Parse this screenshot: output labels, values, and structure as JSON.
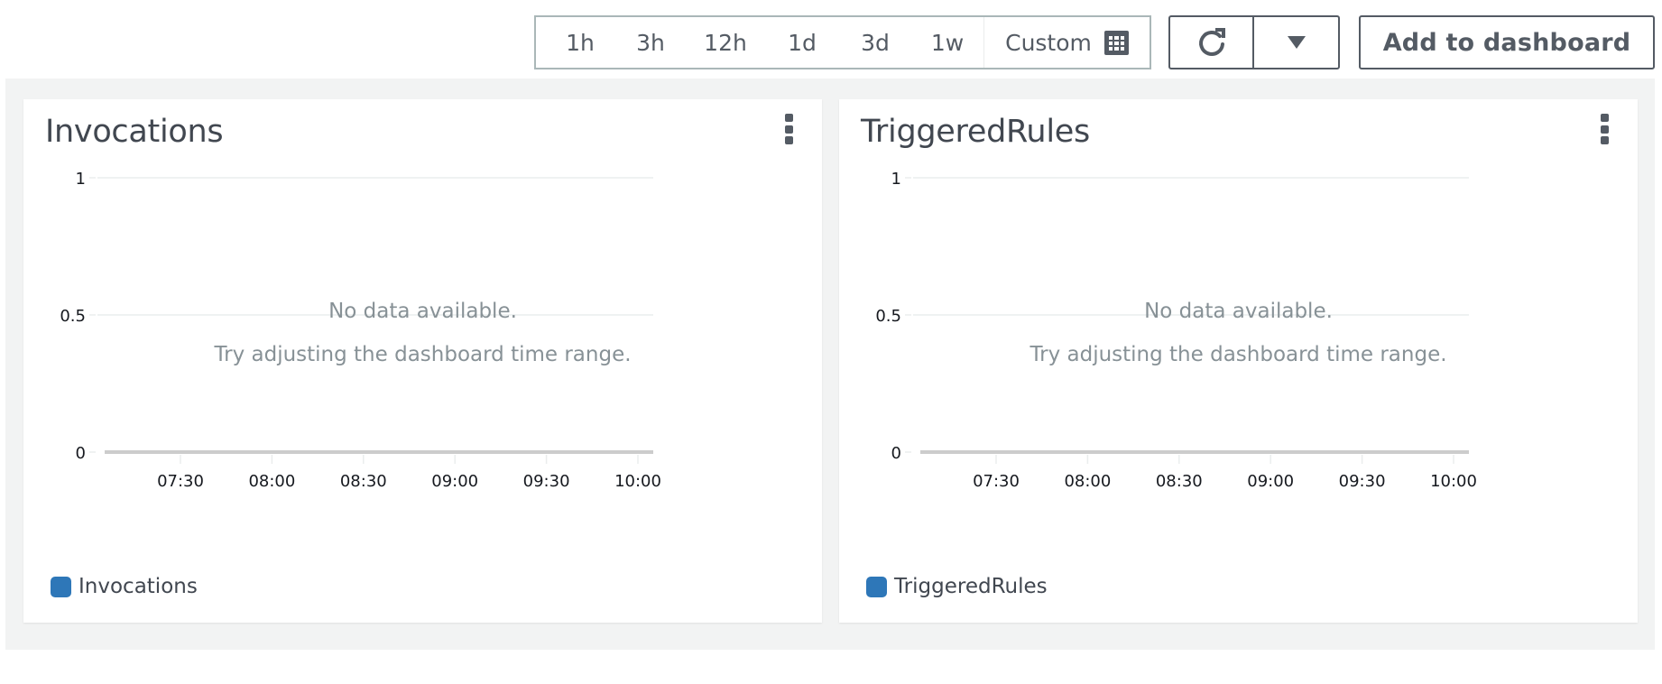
{
  "toolbar": {
    "time_ranges": [
      "1h",
      "3h",
      "12h",
      "1d",
      "3d",
      "1w"
    ],
    "custom_label": "Custom",
    "custom_icon": "calendar-icon",
    "refresh_icon": "refresh-icon",
    "dropdown_icon": "caret-down-icon",
    "add_to_dashboard_label": "Add to dashboard"
  },
  "widgets": [
    {
      "title": "Invocations",
      "menu_icon": "more-vertical-icon",
      "no_data_line1": "No data available.",
      "no_data_line2": "Try adjusting the dashboard time range.",
      "legend_label": "Invocations"
    },
    {
      "title": "TriggeredRules",
      "menu_icon": "more-vertical-icon",
      "no_data_line1": "No data available.",
      "no_data_line2": "Try adjusting the dashboard time range.",
      "legend_label": "TriggeredRules"
    }
  ],
  "colors": {
    "series": "#2e77b8",
    "text_secondary": "#879196",
    "border": "#545b64"
  },
  "chart_data": [
    {
      "type": "line",
      "title": "Invocations",
      "xlabel": "",
      "ylabel": "",
      "ylim": [
        0,
        1
      ],
      "y_ticks": [
        "0",
        "0.5",
        "1"
      ],
      "x_ticks": [
        "07:30",
        "08:00",
        "08:30",
        "09:00",
        "09:30",
        "10:00"
      ],
      "grid": true,
      "legend": "bottom-left",
      "series": [
        {
          "name": "Invocations",
          "values": []
        }
      ],
      "annotation": "No data available. Try adjusting the dashboard time range."
    },
    {
      "type": "line",
      "title": "TriggeredRules",
      "xlabel": "",
      "ylabel": "",
      "ylim": [
        0,
        1
      ],
      "y_ticks": [
        "0",
        "0.5",
        "1"
      ],
      "x_ticks": [
        "07:30",
        "08:00",
        "08:30",
        "09:00",
        "09:30",
        "10:00"
      ],
      "grid": true,
      "legend": "bottom-left",
      "series": [
        {
          "name": "TriggeredRules",
          "values": []
        }
      ],
      "annotation": "No data available. Try adjusting the dashboard time range."
    }
  ]
}
